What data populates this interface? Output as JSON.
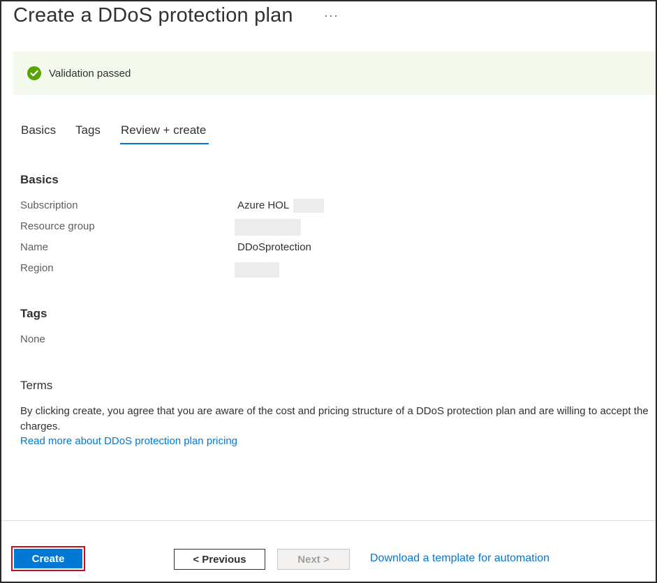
{
  "page": {
    "title": "Create a DDoS protection plan",
    "more_label": "···"
  },
  "banner": {
    "icon": "check-circle-icon",
    "text": "Validation passed",
    "color": "#57a300"
  },
  "tabs": [
    {
      "label": "Basics",
      "active": false
    },
    {
      "label": "Tags",
      "active": false
    },
    {
      "label": "Review + create",
      "active": true
    }
  ],
  "basics": {
    "heading": "Basics",
    "fields": [
      {
        "label": "Subscription",
        "value": "Azure HOL"
      },
      {
        "label": "Resource group",
        "value": ""
      },
      {
        "label": "Name",
        "value": "DDoSprotection"
      },
      {
        "label": "Region",
        "value": ""
      }
    ]
  },
  "tags": {
    "heading": "Tags",
    "value": "None"
  },
  "terms": {
    "heading": "Terms",
    "text": "By clicking create, you agree that you are aware of the cost and pricing structure of a DDoS protection plan and are willing to accept the charges.",
    "link": "Read more about DDoS protection plan pricing"
  },
  "footer": {
    "create_label": "Create",
    "previous_label": "< Previous",
    "next_label": "Next >",
    "download_label": "Download a template for automation"
  },
  "colors": {
    "accent": "#0078d4",
    "highlight_border": "#c50f1f",
    "banner_bg": "#f3f9ed"
  }
}
